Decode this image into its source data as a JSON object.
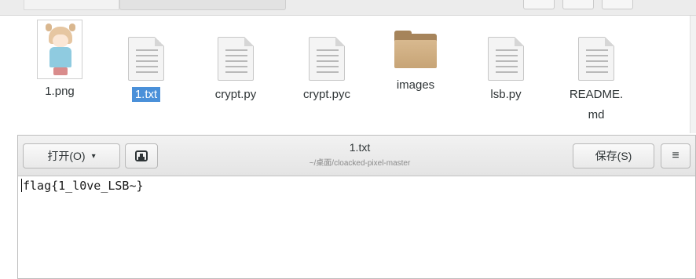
{
  "file_manager": {
    "files": [
      {
        "label": "1.png",
        "icon": "image-thumbnail-icon",
        "selected": false
      },
      {
        "label": "1.txt",
        "icon": "text-file-icon",
        "selected": true
      },
      {
        "label": "crypt.py",
        "icon": "text-file-icon",
        "selected": false
      },
      {
        "label": "crypt.pyc",
        "icon": "text-file-icon",
        "selected": false
      },
      {
        "label": "images",
        "icon": "folder-icon",
        "selected": false
      },
      {
        "label": "lsb.py",
        "icon": "text-file-icon",
        "selected": false
      },
      {
        "label_line1": "README.",
        "label_line2": "md",
        "icon": "text-file-icon",
        "selected": false
      }
    ]
  },
  "editor": {
    "open_label": "打开(O)",
    "open_caret": "▾",
    "title": "1.txt",
    "subtitle": "~/桌面/cloacked-pixel-master",
    "save_label": "保存(S)",
    "menu_glyph": "≡",
    "content": "flag{1_l0ve_LSB~}"
  },
  "colors": {
    "selection": "#4a90d9",
    "folder": "#c7a476"
  }
}
